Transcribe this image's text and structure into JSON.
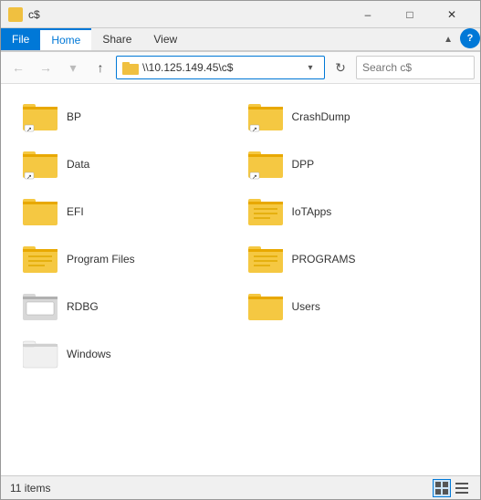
{
  "titleBar": {
    "icon": "folder",
    "title": "c$",
    "minimizeLabel": "–",
    "maximizeLabel": "□",
    "closeLabel": "✕"
  },
  "ribbon": {
    "tabs": [
      {
        "id": "file",
        "label": "File",
        "active": false,
        "isFile": true
      },
      {
        "id": "home",
        "label": "Home",
        "active": true
      },
      {
        "id": "share",
        "label": "Share",
        "active": false
      },
      {
        "id": "view",
        "label": "View",
        "active": false
      }
    ]
  },
  "toolbar": {
    "backLabel": "←",
    "forwardLabel": "→",
    "dropdownLabel": "▾",
    "upLabel": "↑",
    "addressText": "\\\\10.125.149.45\\c$",
    "refreshLabel": "↻",
    "searchPlaceholder": "Search c$",
    "helpLabel": "?"
  },
  "files": [
    {
      "id": "bp",
      "name": "BP",
      "type": "folder-shortcut"
    },
    {
      "id": "crashdump",
      "name": "CrashDump",
      "type": "folder-shortcut"
    },
    {
      "id": "data",
      "name": "Data",
      "type": "folder-shortcut"
    },
    {
      "id": "dpp",
      "name": "DPP",
      "type": "folder-shortcut"
    },
    {
      "id": "efi",
      "name": "EFI",
      "type": "folder-plain"
    },
    {
      "id": "iotapps",
      "name": "IoTApps",
      "type": "folder-lines"
    },
    {
      "id": "program-files",
      "name": "Program Files",
      "type": "folder-lines"
    },
    {
      "id": "programs",
      "name": "PROGRAMS",
      "type": "folder-lines"
    },
    {
      "id": "rdbg",
      "name": "RDBG",
      "type": "folder-special"
    },
    {
      "id": "users",
      "name": "Users",
      "type": "folder-plain"
    },
    {
      "id": "windows",
      "name": "Windows",
      "type": "folder-ghost"
    }
  ],
  "statusBar": {
    "itemCount": "11 items",
    "viewModes": [
      "⊞",
      "☰"
    ]
  }
}
